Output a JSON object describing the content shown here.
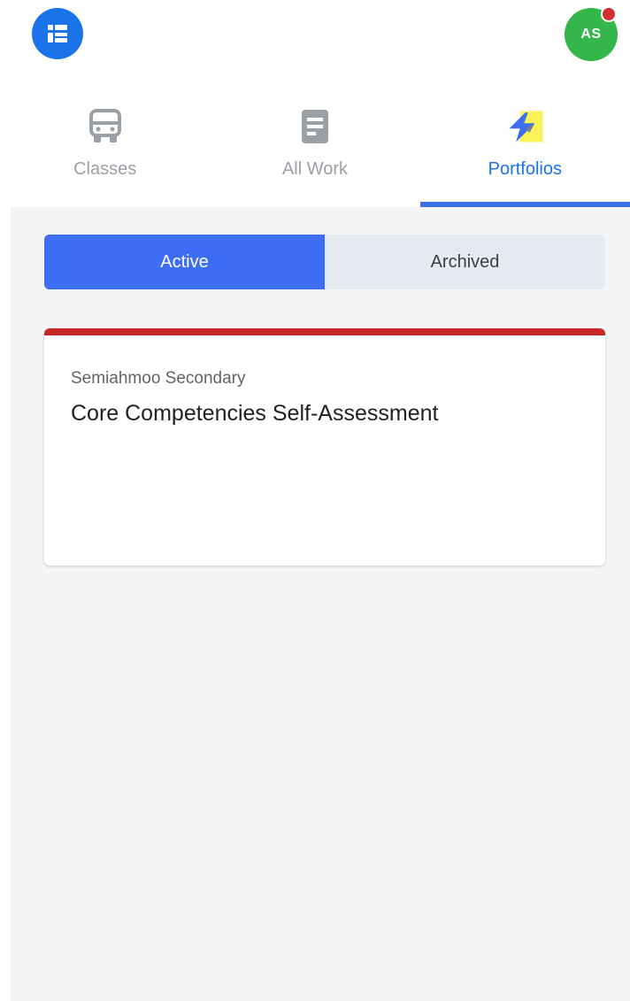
{
  "header": {
    "logo_icon": "list-logo-icon",
    "avatar_initials": "AS",
    "notification_color": "#d32f2f",
    "avatar_color": "#34b64a",
    "logo_color": "#1a73e8"
  },
  "tabs": [
    {
      "label": "Classes",
      "icon": "bus-icon",
      "active": false
    },
    {
      "label": "All Work",
      "icon": "document-icon",
      "active": false
    },
    {
      "label": "Portfolios",
      "icon": "lightning-icon",
      "active": true
    }
  ],
  "filter": {
    "active_label": "Active",
    "archived_label": "Archived",
    "selected": "Active"
  },
  "portfolios": [
    {
      "school": "Semiahmoo Secondary",
      "title": "Core Competencies Self-Assessment",
      "accent_color": "#c62828"
    }
  ],
  "colors": {
    "primary": "#3d6df5",
    "tab_active": "#1a73e8",
    "tab_inactive": "#9aa0a6",
    "background": "#f4f5f7"
  }
}
